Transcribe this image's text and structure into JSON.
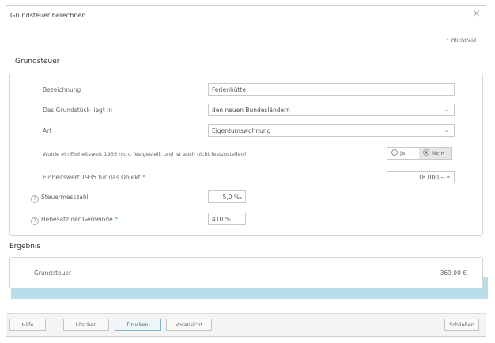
{
  "dialog": {
    "title": "Grundsteuer berechnen",
    "close_glyph": "×",
    "required_note": "Pflichtfeld",
    "required_marker": "*"
  },
  "section_grundsteuer": {
    "heading": "Grundsteuer",
    "bezeichnung": {
      "label": "Bezeichnung",
      "value": "Ferienhütte"
    },
    "grundstueck": {
      "label": "Das Grundstück liegt in",
      "value": "den neuen Bundesländern"
    },
    "art": {
      "label": "Art",
      "value": "Eigentumswohnung"
    },
    "einheitswert_frage": {
      "label": "Wurde ein Einheitswert 1935 nicht festgestellt und ist auch nicht festzustellen?",
      "options": [
        "Ja",
        "Nein"
      ],
      "selected": "Nein"
    },
    "einheitswert": {
      "label": "Einheitswert 1935 für das Objekt",
      "value": "18.000,-- €"
    },
    "steuermesszahl": {
      "label": "Steuermesszahl",
      "value": "5,0 ‰"
    },
    "hebesatz": {
      "label": "Hebesatz der Gemeinde",
      "value": "410 %"
    },
    "help_glyph": "?"
  },
  "section_ergebnis": {
    "heading": "Ergebnis",
    "grundsteuer": {
      "label": "Grundsteuer",
      "value": "369,00 €"
    }
  },
  "footer": {
    "hilfe": "Hilfe",
    "loeschen": "Löschen",
    "drucken": "Drucken",
    "vorschau": "Voransicht",
    "schliessen": "Schließen"
  },
  "colors": {
    "highlight": "#b9dde9",
    "accent": "#3aa8a8"
  },
  "icons": [
    "close-icon",
    "chevron-down-icon",
    "help-icon",
    "radio-icon"
  ]
}
